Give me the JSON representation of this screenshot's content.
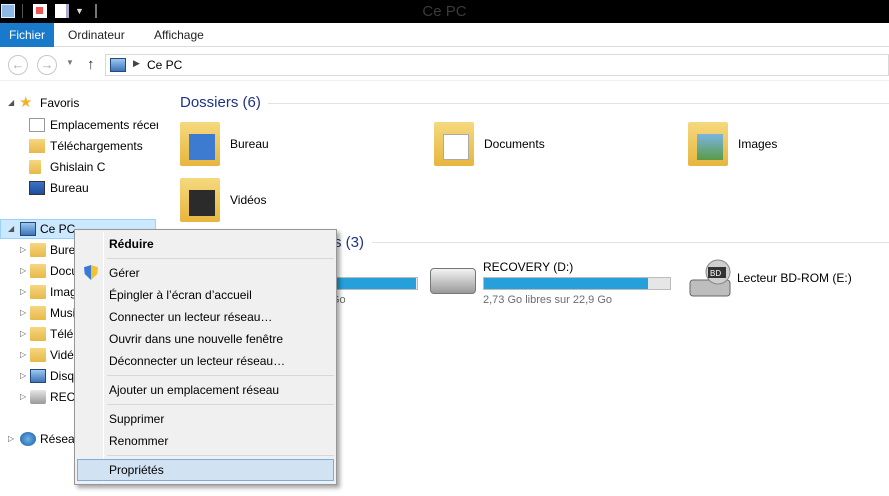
{
  "window": {
    "title": "Ce PC"
  },
  "ribbon": {
    "tabs": [
      "Fichier",
      "Ordinateur",
      "Affichage"
    ]
  },
  "address": {
    "path": "Ce PC"
  },
  "nav": {
    "favorites_label": "Favoris",
    "favorites": [
      "Emplacements récer",
      "Téléchargements",
      "Ghislain C",
      "Bureau"
    ],
    "this_pc_label": "Ce PC",
    "pc_children": [
      "Bure",
      "Docu",
      "Imag",
      "Musi",
      "Télé",
      "Vidé",
      "Disq",
      "RECO"
    ],
    "network_label": "Réseau"
  },
  "content": {
    "folders_header": "Dossiers (6)",
    "folders": [
      "Bureau",
      "Documents",
      "Images",
      "Vidéos"
    ],
    "devices_header_partial": "s (3)",
    "drives": [
      {
        "name": "",
        "sub": "Go",
        "fill": 0.99
      },
      {
        "name": "RECOVERY (D:)",
        "sub": "2,73 Go libres sur 22,9 Go",
        "fill": 0.88
      },
      {
        "name": "Lecteur BD-ROM (E:)",
        "sub": ""
      }
    ]
  },
  "context_menu": {
    "items": [
      "Réduire",
      "Gérer",
      "Épingler à l’écran d’accueil",
      "Connecter un lecteur réseau…",
      "Ouvrir dans une nouvelle fenêtre",
      "Déconnecter un lecteur réseau…",
      "Ajouter un emplacement réseau",
      "Supprimer",
      "Renommer",
      "Propriétés"
    ]
  },
  "colors": {
    "accent": "#1979ca",
    "header": "#1e3287",
    "bar": "#26a0da"
  }
}
